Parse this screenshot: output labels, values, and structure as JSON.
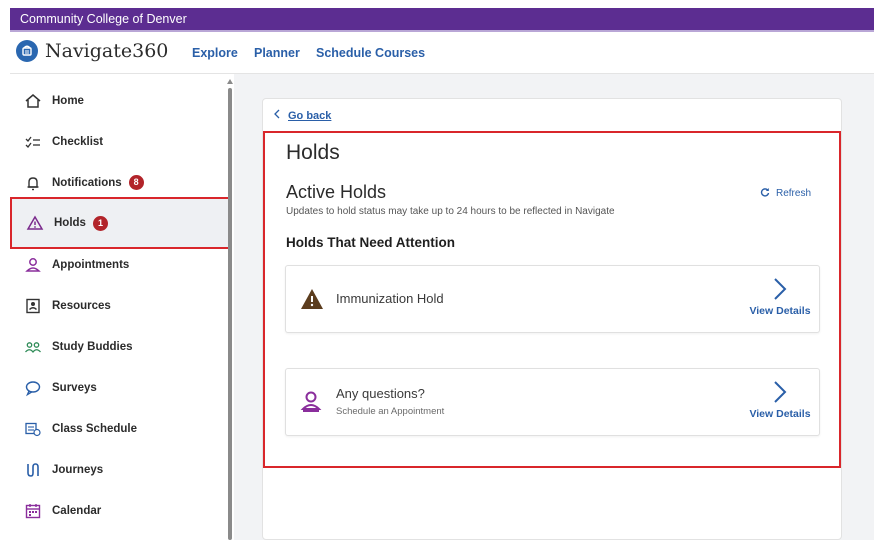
{
  "institution": "Community College of Denver",
  "app": {
    "name": "Navigate360"
  },
  "topnav": [
    "Explore",
    "Planner",
    "Schedule Courses"
  ],
  "sidebar": {
    "items": [
      {
        "label": "Home",
        "icon": "home-icon"
      },
      {
        "label": "Checklist",
        "icon": "checklist-icon"
      },
      {
        "label": "Notifications",
        "icon": "bell-icon",
        "badge": "8"
      },
      {
        "label": "Holds",
        "icon": "warning-icon",
        "badge": "1",
        "active": true
      },
      {
        "label": "Appointments",
        "icon": "person-icon"
      },
      {
        "label": "Resources",
        "icon": "resources-icon"
      },
      {
        "label": "Study Buddies",
        "icon": "study-buddies-icon"
      },
      {
        "label": "Surveys",
        "icon": "chat-bubble-icon"
      },
      {
        "label": "Class Schedule",
        "icon": "class-schedule-icon"
      },
      {
        "label": "Journeys",
        "icon": "journeys-icon"
      },
      {
        "label": "Calendar",
        "icon": "calendar-icon"
      }
    ]
  },
  "main": {
    "go_back": "Go back",
    "title": "Holds",
    "section_title": "Active Holds",
    "section_sub": "Updates to hold status may take up to 24 hours to be reflected in Navigate",
    "refresh_label": "Refresh",
    "attention_title": "Holds That Need Attention",
    "holds": [
      {
        "name": "Immunization Hold",
        "details_label": "View Details",
        "icon": "warning-triangle-icon"
      }
    ],
    "questions": {
      "title": "Any questions?",
      "subtitle": "Schedule an Appointment",
      "details_label": "View Details",
      "icon": "person-icon"
    }
  },
  "colors": {
    "brand_purple": "#5c2d91",
    "link_blue": "#2a5fa8",
    "badge_red": "#b2242a",
    "highlight_red": "#d9262b"
  }
}
